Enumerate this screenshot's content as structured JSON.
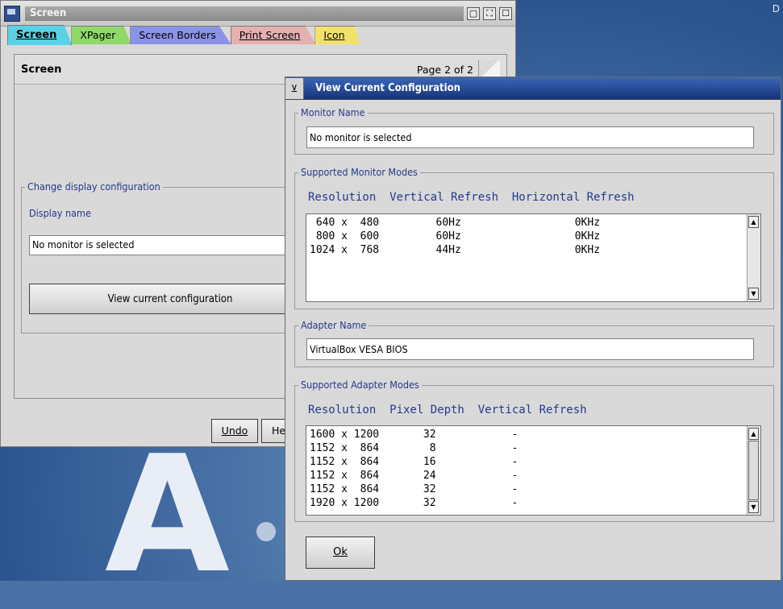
{
  "desktop": {
    "corner_text": "D",
    "logo_text": "A"
  },
  "screen_window": {
    "title": "Screen",
    "tabs": [
      {
        "label": "Screen",
        "color": "#5ad2e6"
      },
      {
        "label": "XPager",
        "color": "#8fd96a"
      },
      {
        "label": "Screen Borders",
        "color": "#8a93e6"
      },
      {
        "label": "Print Screen",
        "color": "#e6b0b0"
      },
      {
        "label": "Icon",
        "color": "#f3e26a"
      }
    ],
    "page": {
      "title": "Screen",
      "page_indicator": "Page 2 of 2",
      "group_label": "Change display configuration",
      "display_name_label": "Display name",
      "display_name_value": "No monitor is selected",
      "view_button": "View current configuration"
    },
    "buttons": {
      "undo": "Undo",
      "help": "He"
    }
  },
  "dialog": {
    "title": "View Current Configuration",
    "monitor_name_label": "Monitor Name",
    "monitor_name_value": "No monitor is selected",
    "monitor_modes_label": "Supported Monitor Modes",
    "monitor_modes_header": "Resolution  Vertical Refresh  Horizontal Refresh",
    "monitor_modes": [
      " 640 x  480         60Hz                  0KHz",
      " 800 x  600         60Hz                  0KHz",
      "1024 x  768         44Hz                  0KHz"
    ],
    "adapter_name_label": "Adapter Name",
    "adapter_name_value": "VirtualBox VESA BIOS",
    "adapter_modes_label": "Supported Adapter Modes",
    "adapter_modes_header": "Resolution  Pixel Depth  Vertical Refresh",
    "adapter_modes": [
      "1600 x 1200       32            -",
      "1152 x  864        8            -",
      "1152 x  864       16            -",
      "1152 x  864       24            -",
      "1152 x  864       32            -",
      "1920 x 1200       32            -"
    ],
    "ok_button": "Ok"
  }
}
